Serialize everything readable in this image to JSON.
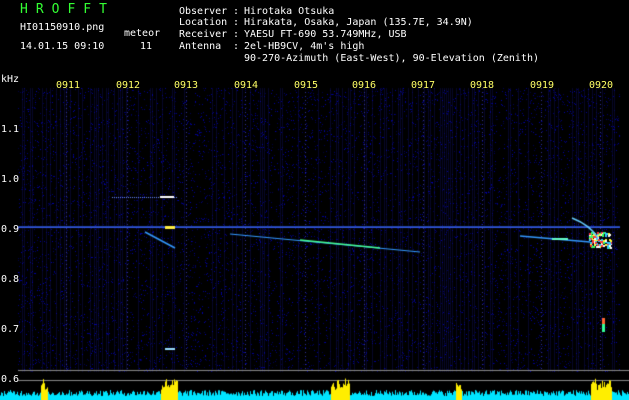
{
  "header": {
    "title": "HROFFT",
    "filename": "HI01150910.png",
    "meteor_label": "meteor",
    "meteor_count": "11",
    "datetime": "14.01.15 09:10",
    "observer_label": "Observer",
    "observer": "Hirotaka Otsuka",
    "location_label": "Location",
    "location": "Hirakata, Osaka, Japan (135.7E, 34.9N)",
    "receiver_label": "Receiver",
    "receiver": "YAESU FT-690 53.749MHz, USB",
    "antenna_label": "Antenna",
    "antenna": "2el-HB9CV, 4m's high",
    "antenna_line2": "90-270-Azimuth (East-West), 90-Elevation (Zenith)"
  },
  "axis": {
    "unit": "kHz",
    "y_ticks": [
      "1.1",
      "1.0",
      "0.9",
      "0.8",
      "0.7",
      "0.6"
    ],
    "x_ticks": [
      "0911",
      "0912",
      "0913",
      "0914",
      "0915",
      "0916",
      "0917",
      "0918",
      "0919",
      "0920"
    ]
  },
  "colors": {
    "background": "#000000",
    "title": "#33ff33",
    "tick_labels": "#ffff66",
    "baseline_fill": "#00e5ff",
    "peak_fill": "#ffee00"
  }
}
